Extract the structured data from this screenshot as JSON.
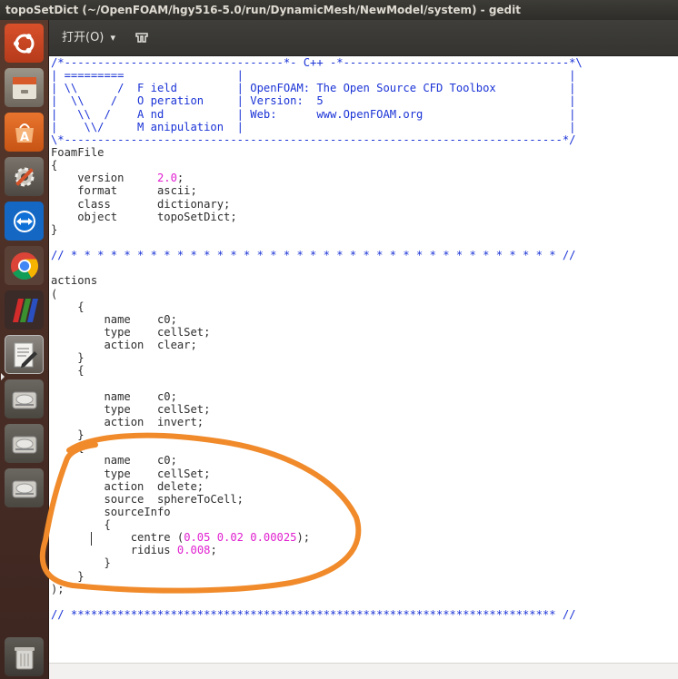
{
  "window": {
    "title": "topoSetDict (~/OpenFOAM/hgy516-5.0/run/DynamicMesh/NewModel/system) - gedit"
  },
  "toolbar": {
    "open_label": "打开(O)",
    "open_arrow": "▾"
  },
  "launcher": {
    "items": [
      "ubuntu-dash",
      "files",
      "software-center",
      "system-settings",
      "teamviewer",
      "chrome",
      "paraview",
      "text-editor",
      "disk-1",
      "disk-2",
      "disk-3",
      "trash"
    ]
  },
  "colors": {
    "comment": "#1a33d6",
    "number": "#e020d0",
    "annotation": "#f08a2a"
  },
  "code": {
    "lines": [
      [
        {
          "t": "/*---------------------------------*- C++ -*----------------------------------*\\",
          "c": "c"
        }
      ],
      [
        {
          "t": "| =========                 |                                                 |",
          "c": "c"
        }
      ],
      [
        {
          "t": "| \\\\      /  F ield         | OpenFOAM: The Open Source CFD Toolbox           |",
          "c": "c"
        }
      ],
      [
        {
          "t": "|  \\\\    /   O peration     | Version:  5                                     |",
          "c": "c"
        }
      ],
      [
        {
          "t": "|   \\\\  /    A nd           | Web:      www.OpenFOAM.org                      |",
          "c": "c"
        }
      ],
      [
        {
          "t": "|    \\\\/     M anipulation  |                                                 |",
          "c": "c"
        }
      ],
      [
        {
          "t": "\\*---------------------------------------------------------------------------*/",
          "c": "c"
        }
      ],
      [
        {
          "t": "FoamFile"
        }
      ],
      [
        {
          "t": "{"
        }
      ],
      [
        {
          "t": "    version     "
        },
        {
          "t": "2.0",
          "c": "n"
        },
        {
          "t": ";"
        }
      ],
      [
        {
          "t": "    format      ascii;"
        }
      ],
      [
        {
          "t": "    class       dictionary;"
        }
      ],
      [
        {
          "t": "    object      topoSetDict;"
        }
      ],
      [
        {
          "t": "}"
        }
      ],
      [
        {
          "t": ""
        }
      ],
      [
        {
          "t": "// * * * * * * * * * * * * * * * * * * * * * * * * * * * * * * * * * * * * * //",
          "c": "c"
        }
      ],
      [
        {
          "t": ""
        }
      ],
      [
        {
          "t": "actions"
        }
      ],
      [
        {
          "t": "("
        }
      ],
      [
        {
          "t": "    {"
        }
      ],
      [
        {
          "t": "        name    c0;"
        }
      ],
      [
        {
          "t": "        type    cellSet;"
        }
      ],
      [
        {
          "t": "        action  clear;"
        }
      ],
      [
        {
          "t": "    }"
        }
      ],
      [
        {
          "t": "    {"
        }
      ],
      [
        {
          "t": ""
        }
      ],
      [
        {
          "t": "        name    c0;"
        }
      ],
      [
        {
          "t": "        type    cellSet;"
        }
      ],
      [
        {
          "t": "        action  invert;"
        }
      ],
      [
        {
          "t": "    }"
        }
      ],
      [
        {
          "t": "    {"
        }
      ],
      [
        {
          "t": "        name    c0;"
        }
      ],
      [
        {
          "t": "        type    cellSet;"
        }
      ],
      [
        {
          "t": "        action  delete;"
        }
      ],
      [
        {
          "t": "        source  sphereToCell;"
        }
      ],
      [
        {
          "t": "        sourceInfo"
        }
      ],
      [
        {
          "t": "        {"
        }
      ],
      [
        {
          "t": "            centre ("
        },
        {
          "t": "0.05 0.02 0.00025",
          "c": "n"
        },
        {
          "t": ");"
        }
      ],
      [
        {
          "t": "            ridius "
        },
        {
          "t": "0.008",
          "c": "n"
        },
        {
          "t": ";"
        }
      ],
      [
        {
          "t": "        }"
        }
      ],
      [
        {
          "t": "    }"
        }
      ],
      [
        {
          "t": ");"
        }
      ],
      [
        {
          "t": ""
        }
      ],
      [
        {
          "t": "// ************************************************************************* //",
          "c": "c"
        }
      ]
    ]
  }
}
